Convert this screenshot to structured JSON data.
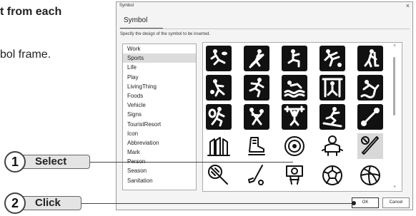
{
  "page": {
    "heading_fragment": "t from each",
    "body_fragment": "bol frame."
  },
  "dialog": {
    "window_title": "Symbol",
    "close_glyph": "×",
    "tab_label": "Symbol",
    "instruction": "Specify the design of the symbol to be inserted.",
    "categories": [
      "Work",
      "Sports",
      "Life",
      "Play",
      "LivingThing",
      "Foods",
      "Vehicle",
      "Signs",
      "TouristResort",
      "Icon",
      "Abbreviation",
      "Mark",
      "Person",
      "Season",
      "Sanitation"
    ],
    "selected_category": "Sports",
    "symbols": [
      {
        "icon": "rugby-tile-icon",
        "style": "tile"
      },
      {
        "icon": "golf-swing-tile-icon",
        "style": "tile"
      },
      {
        "icon": "squatting-athlete-tile-icon",
        "style": "tile"
      },
      {
        "icon": "kicking-tile-icon",
        "style": "tile"
      },
      {
        "icon": "hockey-tile-icon",
        "style": "tile"
      },
      {
        "icon": "table-tennis-tile-icon",
        "style": "tile"
      },
      {
        "icon": "running-tile-icon",
        "style": "tile"
      },
      {
        "icon": "swimming-tile-icon",
        "style": "tile"
      },
      {
        "icon": "gymnastics-bar-tile-icon",
        "style": "tile"
      },
      {
        "icon": "diving-tile-icon",
        "style": "tile"
      },
      {
        "icon": "tennis-tile-icon",
        "style": "tile"
      },
      {
        "icon": "wrestling-tile-icon",
        "style": "tile"
      },
      {
        "icon": "weightlifting-tile-icon",
        "style": "tile"
      },
      {
        "icon": "skiing-tile-icon",
        "style": "tile"
      },
      {
        "icon": "dumbbell-tile-icon",
        "style": "tile"
      },
      {
        "icon": "ski-boots-icon",
        "style": "line"
      },
      {
        "icon": "ice-skate-icon",
        "style": "line"
      },
      {
        "icon": "target-icon",
        "style": "line"
      },
      {
        "icon": "sumo-wrestler-icon",
        "style": "line"
      },
      {
        "icon": "baseball-bat-ball-icon",
        "style": "line",
        "selected": true
      },
      {
        "icon": "badminton-racket-icon",
        "style": "line"
      },
      {
        "icon": "golf-club-icon",
        "style": "line"
      },
      {
        "icon": "basketball-hoop-icon",
        "style": "line"
      },
      {
        "icon": "soccer-ball-icon",
        "style": "line"
      },
      {
        "icon": "volleyball-icon",
        "style": "line"
      }
    ],
    "scroll_up_glyph": "˄",
    "scroll_down_glyph": "˅",
    "ok_label": "OK",
    "cancel_label": "Cancel"
  },
  "callouts": [
    {
      "number": "1",
      "label": "Select"
    },
    {
      "number": "2",
      "label": "Click"
    }
  ]
}
